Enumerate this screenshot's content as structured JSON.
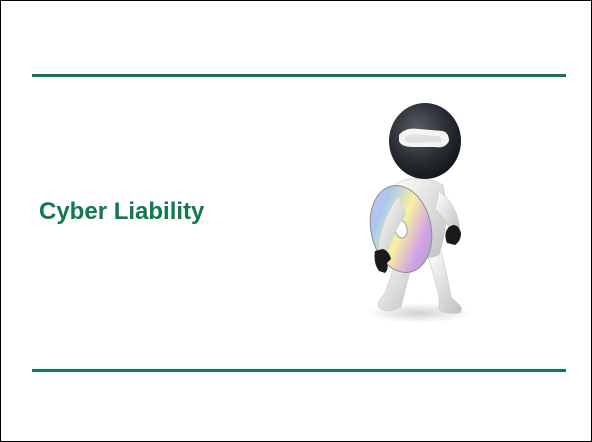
{
  "slide": {
    "title": "Cyber Liability",
    "illustration_icon": "thief-with-cd-icon"
  },
  "colors": {
    "accent": "#0f7a4d",
    "background": "#ffffff",
    "border": "#000000"
  }
}
